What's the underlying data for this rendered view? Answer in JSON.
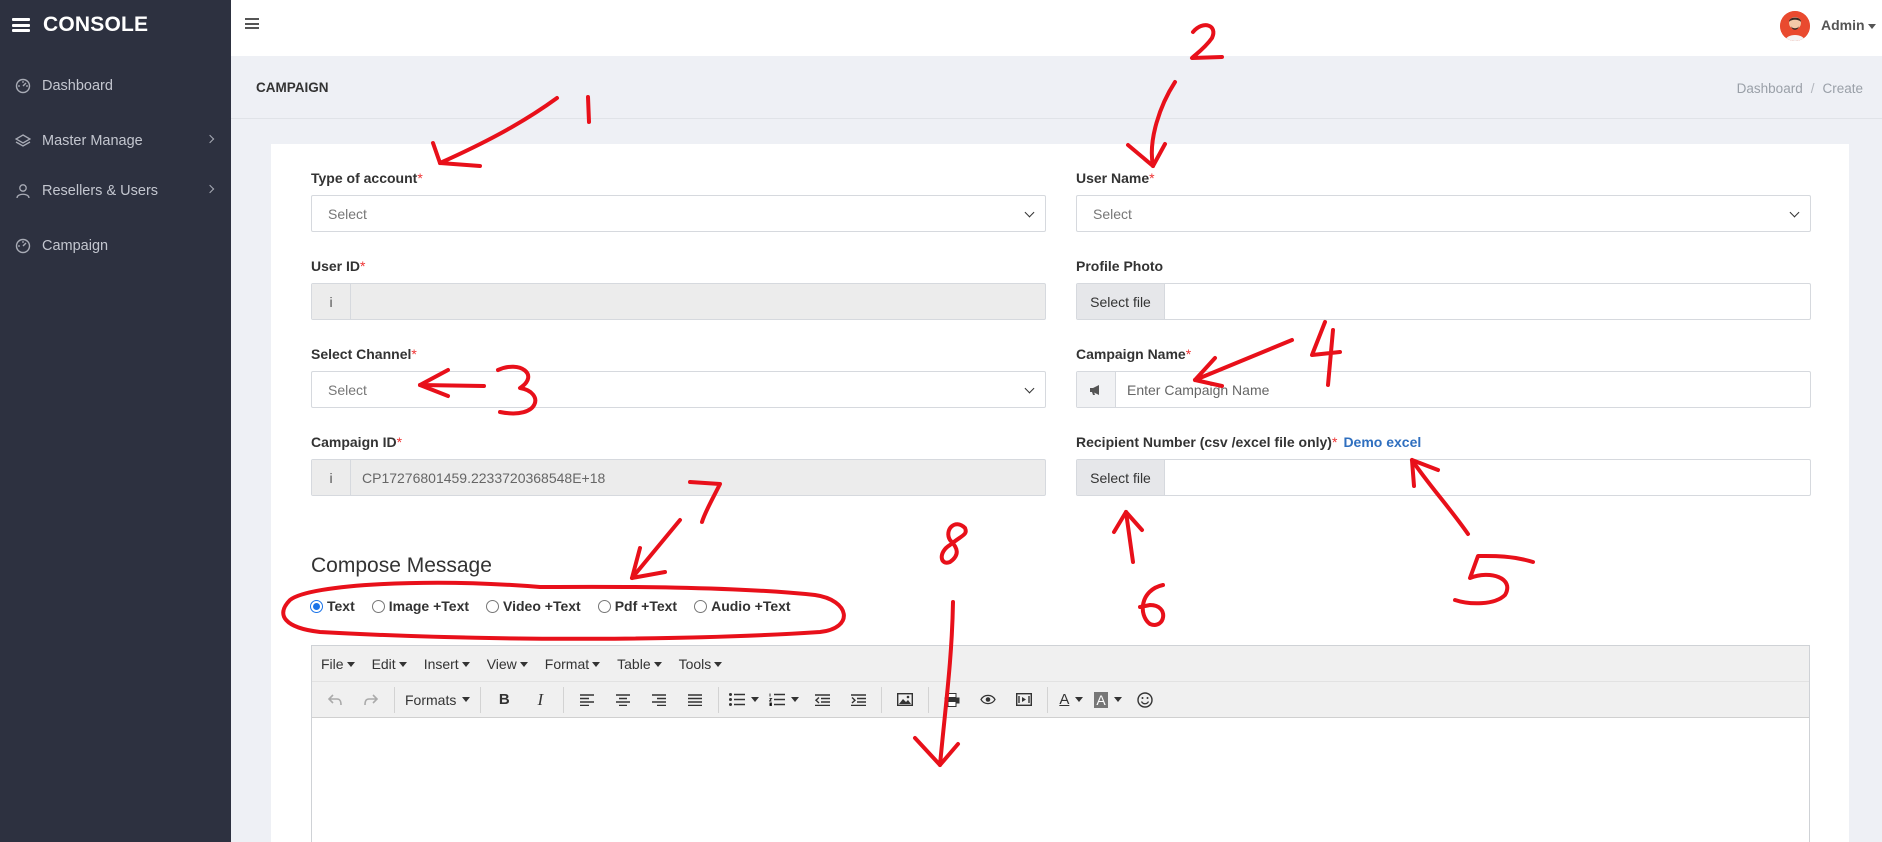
{
  "sidebar": {
    "brand": "CONSOLE",
    "items": [
      {
        "label": "Dashboard",
        "icon": "dashboard-icon"
      },
      {
        "label": "Master Manage",
        "icon": "layers-icon"
      },
      {
        "label": "Resellers & Users",
        "icon": "user-icon"
      },
      {
        "label": "Campaign",
        "icon": "campaign-icon"
      }
    ]
  },
  "topbar": {
    "user": "Admin"
  },
  "header": {
    "title": "CAMPAIGN",
    "breadcrumb": [
      "Dashboard",
      "Create"
    ]
  },
  "form": {
    "type_of_account": {
      "label": "Type of account",
      "value": "Select"
    },
    "user_name": {
      "label": "User Name",
      "value": "Select"
    },
    "user_id": {
      "label": "User ID",
      "value": ""
    },
    "profile_photo": {
      "label": "Profile Photo",
      "button": "Select file"
    },
    "select_channel": {
      "label": "Select Channel",
      "value": "Select"
    },
    "campaign_name": {
      "label": "Campaign Name",
      "placeholder": "Enter Campaign Name"
    },
    "campaign_id": {
      "label": "Campaign ID",
      "value": "CP17276801459.2233720368548E+18"
    },
    "recipient_number": {
      "label": "Recipient Number (csv /excel file only)",
      "link": "Demo excel",
      "button": "Select file"
    },
    "required_mark": "*"
  },
  "compose": {
    "title": "Compose Message",
    "types": [
      {
        "label": "Text",
        "selected": true
      },
      {
        "label": "Image +Text",
        "selected": false
      },
      {
        "label": "Video +Text",
        "selected": false
      },
      {
        "label": "Pdf +Text",
        "selected": false
      },
      {
        "label": "Audio +Text",
        "selected": false
      }
    ]
  },
  "editor": {
    "menus": [
      "File",
      "Edit",
      "Insert",
      "View",
      "Format",
      "Table",
      "Tools"
    ],
    "formats_label": "Formats",
    "bold_glyph": "B",
    "italic_glyph": "I",
    "text_color_glyph": "A",
    "bg_color_glyph": "A"
  },
  "annotations": {
    "color": "#e8101a",
    "labels": [
      "1",
      "2",
      "3",
      "4",
      "5",
      "6",
      "7",
      "8"
    ]
  },
  "colors": {
    "sidebar_bg": "#2d3140",
    "accent_link": "#2f6fbf",
    "required": "#e33333"
  }
}
